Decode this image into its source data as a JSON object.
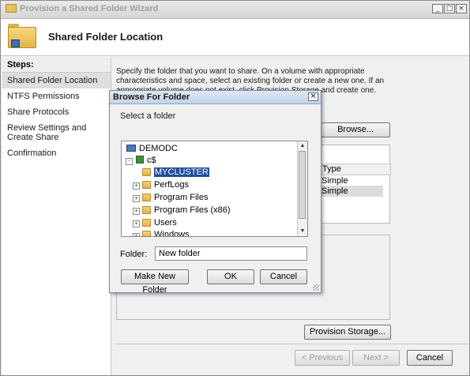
{
  "window": {
    "title": "Provision a Shared Folder Wizard",
    "controls": {
      "minimize": "_",
      "maximize": "□",
      "close": "×"
    }
  },
  "header": {
    "title": "Shared Folder Location"
  },
  "steps": {
    "heading": "Steps:",
    "items": [
      {
        "label": "Shared Folder Location",
        "active": true
      },
      {
        "label": "NTFS Permissions",
        "active": false
      },
      {
        "label": "Share Protocols",
        "active": false
      },
      {
        "label": "Review Settings and Create Share",
        "active": false
      },
      {
        "label": "Confirmation",
        "active": false
      }
    ]
  },
  "main": {
    "description": "Specify the folder that you want to share. On a volume with appropriate characteristics and space, select an existing folder or create a new one. If an appropriate volume does not exist, click Provision Storage and create one.",
    "browse_label": "Browse...",
    "volume_table": {
      "column": "Type",
      "rows": [
        "Simple",
        "Simple"
      ]
    },
    "provision_label": "Provision Storage..."
  },
  "footer": {
    "previous": "< Previous",
    "next": "Next >",
    "cancel": "Cancel"
  },
  "dialog": {
    "title": "Browse For Folder",
    "close": "×",
    "prompt": "Select a folder",
    "tree": [
      {
        "label": "DEMODC",
        "icon": "computer-icon"
      },
      {
        "label": "c$",
        "icon": "drive-icon"
      },
      {
        "label": "MYCLUSTER",
        "icon": "folder-icon",
        "selected": true
      },
      {
        "label": "PerfLogs",
        "icon": "folder-icon"
      },
      {
        "label": "Program Files",
        "icon": "folder-icon"
      },
      {
        "label": "Program Files (x86)",
        "icon": "folder-icon"
      },
      {
        "label": "Users",
        "icon": "folder-icon"
      },
      {
        "label": "Windows",
        "icon": "folder-icon"
      }
    ],
    "folder_label": "Folder:",
    "folder_value": "New folder",
    "make_new_folder": "Make New Folder",
    "ok": "OK",
    "cancel": "Cancel"
  }
}
